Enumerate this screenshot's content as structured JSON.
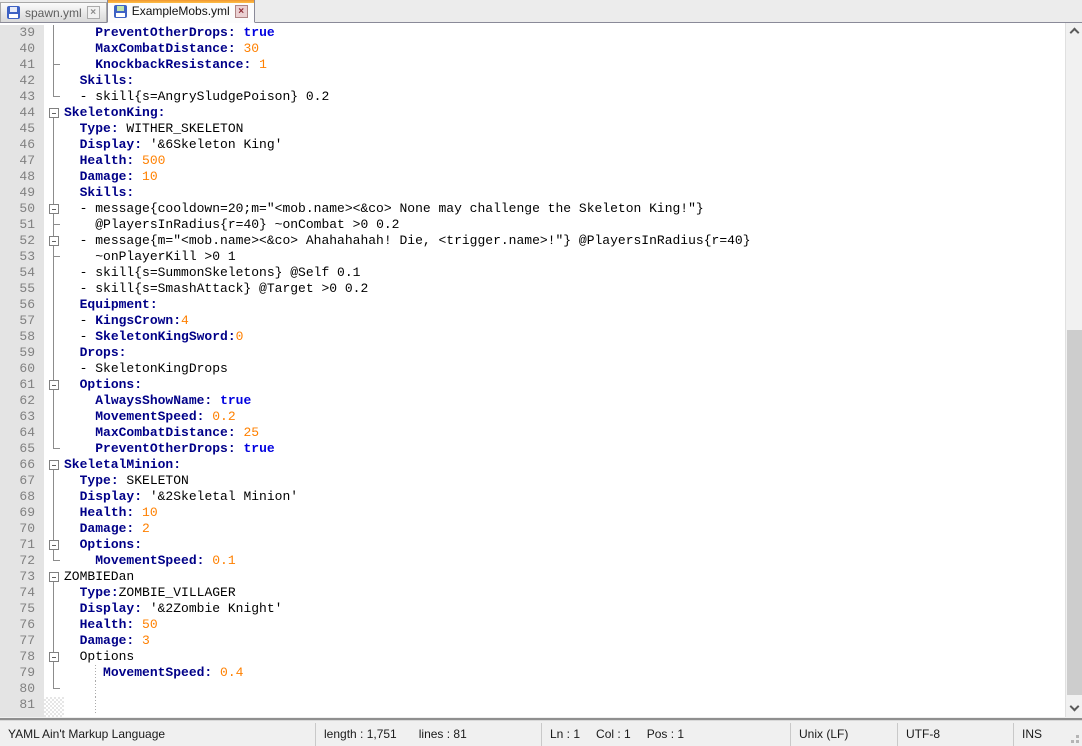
{
  "tabs": [
    {
      "label": "spawn.yml",
      "active": false,
      "close_glyph": "×"
    },
    {
      "label": "ExampleMobs.yml",
      "active": true,
      "close_glyph": "×"
    }
  ],
  "colors": {
    "key": "#000088",
    "keyword": "#0000E0",
    "number": "#FF8000",
    "plain": "#000000",
    "line_number": "#808080",
    "margin_bg": "#E4E4E4",
    "active_tab_accent": "#F5A231"
  },
  "editor": {
    "lines": [
      {
        "n": 39,
        "fold": "v",
        "ind": 4,
        "seg": [
          [
            "k",
            "PreventOtherDrops:"
          ],
          [
            "p",
            " "
          ],
          [
            "w",
            "true"
          ]
        ]
      },
      {
        "n": 40,
        "fold": "v",
        "ind": 4,
        "seg": [
          [
            "k",
            "MaxCombatDistance:"
          ],
          [
            "p",
            " "
          ],
          [
            "n",
            "30"
          ]
        ]
      },
      {
        "n": 41,
        "fold": "t",
        "ind": 4,
        "seg": [
          [
            "k",
            "KnockbackResistance:"
          ],
          [
            "p",
            " "
          ],
          [
            "n",
            "1"
          ]
        ]
      },
      {
        "n": 42,
        "fold": "v",
        "ind": 2,
        "seg": [
          [
            "k",
            "Skills:"
          ]
        ]
      },
      {
        "n": 43,
        "fold": "c",
        "ind": 2,
        "seg": [
          [
            "p",
            "- skill{s=AngrySludgePoison} 0.2"
          ]
        ]
      },
      {
        "n": 44,
        "fold": "bs",
        "ind": 0,
        "seg": [
          [
            "k",
            "SkeletonKing:"
          ]
        ]
      },
      {
        "n": 45,
        "fold": "v",
        "ind": 2,
        "seg": [
          [
            "k",
            "Type:"
          ],
          [
            "p",
            " WITHER_SKELETON"
          ]
        ]
      },
      {
        "n": 46,
        "fold": "v",
        "ind": 2,
        "seg": [
          [
            "k",
            "Display:"
          ],
          [
            "p",
            " '&6Skeleton King'"
          ]
        ]
      },
      {
        "n": 47,
        "fold": "v",
        "ind": 2,
        "seg": [
          [
            "k",
            "Health:"
          ],
          [
            "p",
            " "
          ],
          [
            "n",
            "500"
          ]
        ]
      },
      {
        "n": 48,
        "fold": "v",
        "ind": 2,
        "seg": [
          [
            "k",
            "Damage:"
          ],
          [
            "p",
            " "
          ],
          [
            "n",
            "10"
          ]
        ]
      },
      {
        "n": 49,
        "fold": "v",
        "ind": 2,
        "seg": [
          [
            "k",
            "Skills:"
          ]
        ]
      },
      {
        "n": 50,
        "fold": "b",
        "ind": 2,
        "seg": [
          [
            "p",
            "- message{cooldown=20;m=\"<mob.name><&co> None may challenge the Skeleton King!\"}"
          ]
        ]
      },
      {
        "n": 51,
        "fold": "t",
        "ind": 4,
        "seg": [
          [
            "p",
            "@PlayersInRadius{r=40} ~onCombat >0 0.2"
          ]
        ]
      },
      {
        "n": 52,
        "fold": "b",
        "ind": 2,
        "seg": [
          [
            "p",
            "- message{m=\"<mob.name><&co> Ahahahahah! Die, <trigger.name>!\"} @PlayersInRadius{r=40}"
          ]
        ]
      },
      {
        "n": 53,
        "fold": "t",
        "ind": 4,
        "seg": [
          [
            "p",
            "~onPlayerKill >0 1"
          ]
        ]
      },
      {
        "n": 54,
        "fold": "v",
        "ind": 2,
        "seg": [
          [
            "p",
            "- skill{s=SummonSkeletons} @Self 0.1"
          ]
        ]
      },
      {
        "n": 55,
        "fold": "v",
        "ind": 2,
        "seg": [
          [
            "p",
            "- skill{s=SmashAttack} @Target >0 0.2"
          ]
        ]
      },
      {
        "n": 56,
        "fold": "v",
        "ind": 2,
        "seg": [
          [
            "k",
            "Equipment:"
          ]
        ]
      },
      {
        "n": 57,
        "fold": "v",
        "ind": 2,
        "seg": [
          [
            "p",
            "- "
          ],
          [
            "k",
            "KingsCrown:"
          ],
          [
            "n",
            "4"
          ]
        ]
      },
      {
        "n": 58,
        "fold": "v",
        "ind": 2,
        "seg": [
          [
            "p",
            "- "
          ],
          [
            "k",
            "SkeletonKingSword:"
          ],
          [
            "n",
            "0"
          ]
        ]
      },
      {
        "n": 59,
        "fold": "v",
        "ind": 2,
        "seg": [
          [
            "k",
            "Drops:"
          ]
        ]
      },
      {
        "n": 60,
        "fold": "v",
        "ind": 2,
        "seg": [
          [
            "p",
            "- SkeletonKingDrops"
          ]
        ]
      },
      {
        "n": 61,
        "fold": "b",
        "ind": 2,
        "seg": [
          [
            "k",
            "Options:"
          ]
        ]
      },
      {
        "n": 62,
        "fold": "v",
        "ind": 4,
        "seg": [
          [
            "k",
            "AlwaysShowName:"
          ],
          [
            "p",
            " "
          ],
          [
            "w",
            "true"
          ]
        ]
      },
      {
        "n": 63,
        "fold": "v",
        "ind": 4,
        "seg": [
          [
            "k",
            "MovementSpeed:"
          ],
          [
            "p",
            " "
          ],
          [
            "n",
            "0.2"
          ]
        ]
      },
      {
        "n": 64,
        "fold": "v",
        "ind": 4,
        "seg": [
          [
            "k",
            "MaxCombatDistance:"
          ],
          [
            "p",
            " "
          ],
          [
            "n",
            "25"
          ]
        ]
      },
      {
        "n": 65,
        "fold": "c",
        "ind": 4,
        "seg": [
          [
            "k",
            "PreventOtherDrops:"
          ],
          [
            "p",
            " "
          ],
          [
            "w",
            "true"
          ]
        ]
      },
      {
        "n": 66,
        "fold": "bs",
        "ind": 0,
        "seg": [
          [
            "k",
            "SkeletalMinion:"
          ]
        ]
      },
      {
        "n": 67,
        "fold": "v",
        "ind": 2,
        "seg": [
          [
            "k",
            "Type:"
          ],
          [
            "p",
            " SKELETON"
          ]
        ]
      },
      {
        "n": 68,
        "fold": "v",
        "ind": 2,
        "seg": [
          [
            "k",
            "Display:"
          ],
          [
            "p",
            " '&2Skeletal Minion'"
          ]
        ]
      },
      {
        "n": 69,
        "fold": "v",
        "ind": 2,
        "seg": [
          [
            "k",
            "Health:"
          ],
          [
            "p",
            " "
          ],
          [
            "n",
            "10"
          ]
        ]
      },
      {
        "n": 70,
        "fold": "v",
        "ind": 2,
        "seg": [
          [
            "k",
            "Damage:"
          ],
          [
            "p",
            " "
          ],
          [
            "n",
            "2"
          ]
        ]
      },
      {
        "n": 71,
        "fold": "b",
        "ind": 2,
        "seg": [
          [
            "k",
            "Options:"
          ]
        ]
      },
      {
        "n": 72,
        "fold": "c",
        "ind": 4,
        "seg": [
          [
            "k",
            "MovementSpeed:"
          ],
          [
            "p",
            " "
          ],
          [
            "n",
            "0.1"
          ]
        ]
      },
      {
        "n": 73,
        "fold": "bs",
        "ind": 0,
        "seg": [
          [
            "p",
            "ZOMBIEDan"
          ]
        ]
      },
      {
        "n": 74,
        "fold": "v",
        "ind": 2,
        "seg": [
          [
            "k",
            "Type:"
          ],
          [
            "p",
            "ZOMBIE_VILLAGER"
          ]
        ]
      },
      {
        "n": 75,
        "fold": "v",
        "ind": 2,
        "seg": [
          [
            "k",
            "Display:"
          ],
          [
            "p",
            " '&2Zombie Knight'"
          ]
        ]
      },
      {
        "n": 76,
        "fold": "v",
        "ind": 2,
        "seg": [
          [
            "k",
            "Health:"
          ],
          [
            "p",
            " "
          ],
          [
            "n",
            "50"
          ]
        ]
      },
      {
        "n": 77,
        "fold": "v",
        "ind": 2,
        "seg": [
          [
            "k",
            "Damage:"
          ],
          [
            "p",
            " "
          ],
          [
            "n",
            "3"
          ]
        ]
      },
      {
        "n": 78,
        "fold": "b",
        "ind": 2,
        "seg": [
          [
            "p",
            "Options"
          ]
        ]
      },
      {
        "n": 79,
        "fold": "v",
        "ind": 5,
        "guide": true,
        "seg": [
          [
            "k",
            "MovementSpeed:"
          ],
          [
            "p",
            " "
          ],
          [
            "n",
            "0.4"
          ]
        ]
      },
      {
        "n": 80,
        "fold": "c",
        "ind": 0,
        "guide": true,
        "seg": []
      },
      {
        "n": 81,
        "fold": "x",
        "ind": 0,
        "guide": true,
        "seg": []
      }
    ]
  },
  "status": {
    "doc_type": "YAML Ain't Markup Language",
    "length_label": "length : 1,751",
    "lines_label": "lines : 81",
    "ln_label": "Ln : 1",
    "col_label": "Col : 1",
    "pos_label": "Pos : 1",
    "eol": "Unix (LF)",
    "encoding": "UTF-8",
    "mode": "INS"
  }
}
